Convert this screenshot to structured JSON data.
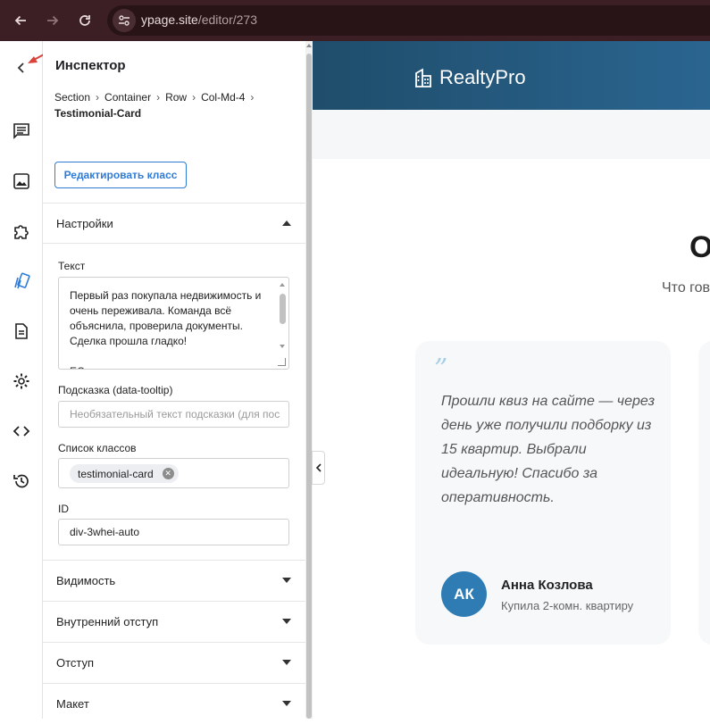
{
  "browser": {
    "url_host": "ypage.site",
    "url_path": "/editor/273",
    "icons": [
      "back-icon",
      "forward-icon",
      "reload-icon",
      "site-settings-icon"
    ]
  },
  "rail": {
    "icons": [
      "chevron-left-icon",
      "comment-icon",
      "image-icon",
      "puzzle-icon",
      "style-icon",
      "document-icon",
      "gear-icon",
      "code-icon",
      "history-icon"
    ]
  },
  "inspector": {
    "title": "Инспектор",
    "breadcrumb": [
      "Section",
      "Container",
      "Row",
      "Col-Md-4",
      "Testimonial-Card"
    ],
    "edit_class_label": "Редактировать класс",
    "settings": {
      "title": "Настройки",
      "text_label": "Текст",
      "text_value": "Первый раз покупала недвижимость и очень переживала. Команда всё объяснила, проверила документы. Сделка прошла гладко!\n\nЕС",
      "tooltip_label": "Подсказка (data-tooltip)",
      "tooltip_placeholder": "Необязательный текст подсказки (для пос",
      "classes_label": "Список классов",
      "class_chip": "testimonial-card",
      "id_label": "ID",
      "id_value": "div-3whei-auto"
    },
    "sections": {
      "visibility": "Видимость",
      "padding": "Внутренний отступ",
      "margin": "Отступ",
      "layout": "Макет"
    }
  },
  "preview": {
    "brand": "RealtyPro",
    "section_title_fragment": "О",
    "section_subtitle_fragment": "Что гов",
    "card": {
      "quote_mark": "”",
      "quote": "Прошли квиз на сайте — через день уже получили подборку из 15 квартир. Выбрали идеальную! Спасибо за оперативность.",
      "avatar_initials": "АК",
      "author_name": "Анна Козлова",
      "author_role": "Купила 2-комн. квартиру"
    }
  },
  "colors": {
    "browser_bar": "#3c1f24",
    "accent": "#2f7bd6",
    "site_header": "#1f4d6b",
    "avatar": "#2e7cb3",
    "annotation": "#d8423a"
  }
}
